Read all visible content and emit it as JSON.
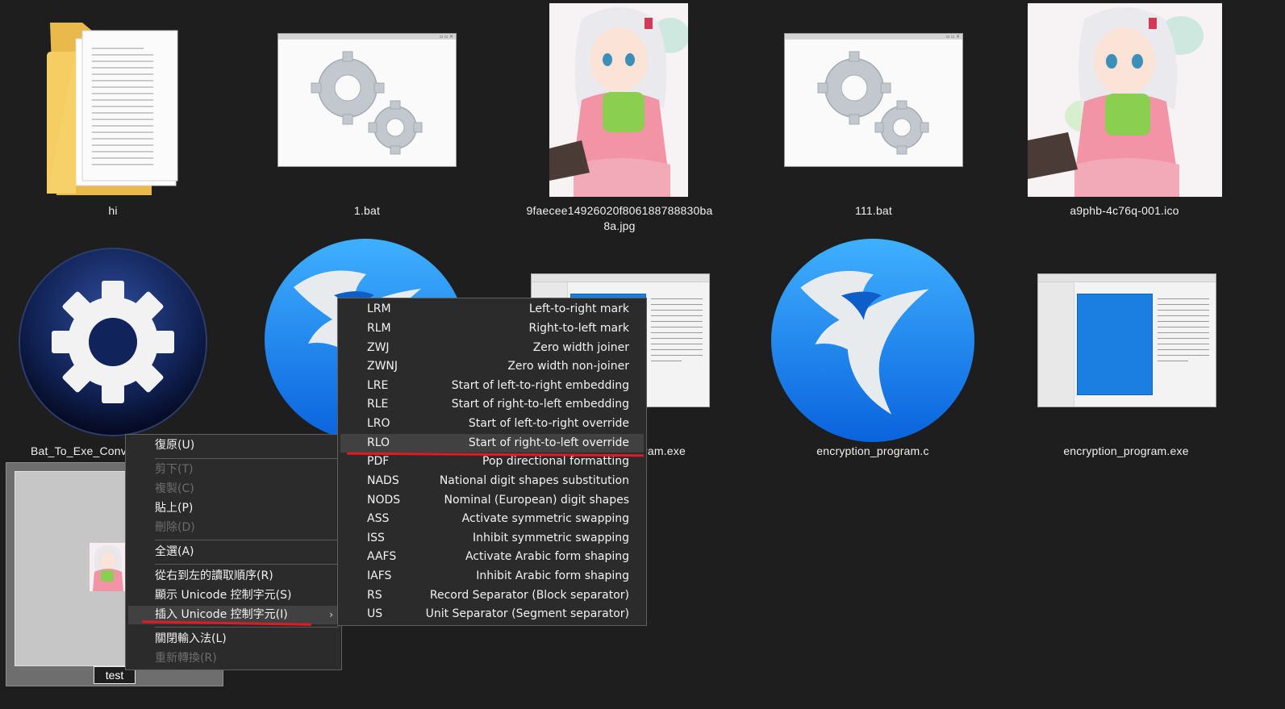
{
  "files": [
    {
      "name": "hi",
      "type": "folder"
    },
    {
      "name": "1.bat",
      "type": "bat"
    },
    {
      "name": "9faecee14926020f806188788830ba",
      "name_line2": "8a.jpg",
      "type": "image"
    },
    {
      "name": "111.bat",
      "type": "bat"
    },
    {
      "name": "a9phb-4c76q-001.ico",
      "type": "image"
    },
    {
      "name": "Bat_To_Exe_Conv",
      "type": "settings-app"
    },
    {
      "name": "",
      "type": "blue-app"
    },
    {
      "name": "ram.exe",
      "type": "exe"
    },
    {
      "name": "encryption_program.c",
      "type": "blue-app"
    },
    {
      "name": "encryption_program.exe",
      "type": "exe"
    },
    {
      "name": "test",
      "type": "image",
      "state": "renaming"
    }
  ],
  "context_menu": {
    "items": [
      {
        "label": "復原(U)",
        "enabled": true
      },
      {
        "label": "剪下(T)",
        "enabled": false
      },
      {
        "label": "複製(C)",
        "enabled": false
      },
      {
        "label": "貼上(P)",
        "enabled": true
      },
      {
        "label": "刪除(D)",
        "enabled": false
      },
      {
        "label": "全選(A)",
        "enabled": true
      },
      {
        "label": "從右到左的讀取順序(R)",
        "enabled": true
      },
      {
        "label": "顯示 Unicode 控制字元(S)",
        "enabled": true
      },
      {
        "label": "插入 Unicode 控制字元(I)",
        "enabled": true,
        "submenu_arrow": "›",
        "highlighted": true
      },
      {
        "label": "關閉輸入法(L)",
        "enabled": true
      },
      {
        "label": "重新轉換(R)",
        "enabled": false
      }
    ]
  },
  "submenu": {
    "items": [
      {
        "code": "LRM",
        "desc": "Left-to-right mark"
      },
      {
        "code": "RLM",
        "desc": "Right-to-left mark"
      },
      {
        "code": "ZWJ",
        "desc": "Zero width joiner"
      },
      {
        "code": "ZWNJ",
        "desc": "Zero width non-joiner"
      },
      {
        "code": "LRE",
        "desc": "Start of left-to-right embedding"
      },
      {
        "code": "RLE",
        "desc": "Start of right-to-left embedding"
      },
      {
        "code": "LRO",
        "desc": "Start of left-to-right override"
      },
      {
        "code": "RLO",
        "desc": "Start of right-to-left override",
        "highlighted": true
      },
      {
        "code": "PDF",
        "desc": "Pop directional formatting"
      },
      {
        "code": "NADS",
        "desc": "National digit shapes substitution"
      },
      {
        "code": "NODS",
        "desc": "Nominal (European) digit shapes"
      },
      {
        "code": "ASS",
        "desc": "Activate symmetric swapping"
      },
      {
        "code": "ISS",
        "desc": "Inhibit symmetric swapping"
      },
      {
        "code": "AAFS",
        "desc": "Activate Arabic form shaping"
      },
      {
        "code": "IAFS",
        "desc": "Inhibit Arabic form shaping"
      },
      {
        "code": "RS",
        "desc": "Record Separator (Block separator)"
      },
      {
        "code": "US",
        "desc": "Unit Separator (Segment separator)"
      }
    ]
  },
  "colors": {
    "background": "#1e1e1e",
    "menu_bg": "#2b2b2b",
    "highlight": "#414141",
    "annotation": "#e21b22",
    "app_blue": "#1a8cf0"
  }
}
